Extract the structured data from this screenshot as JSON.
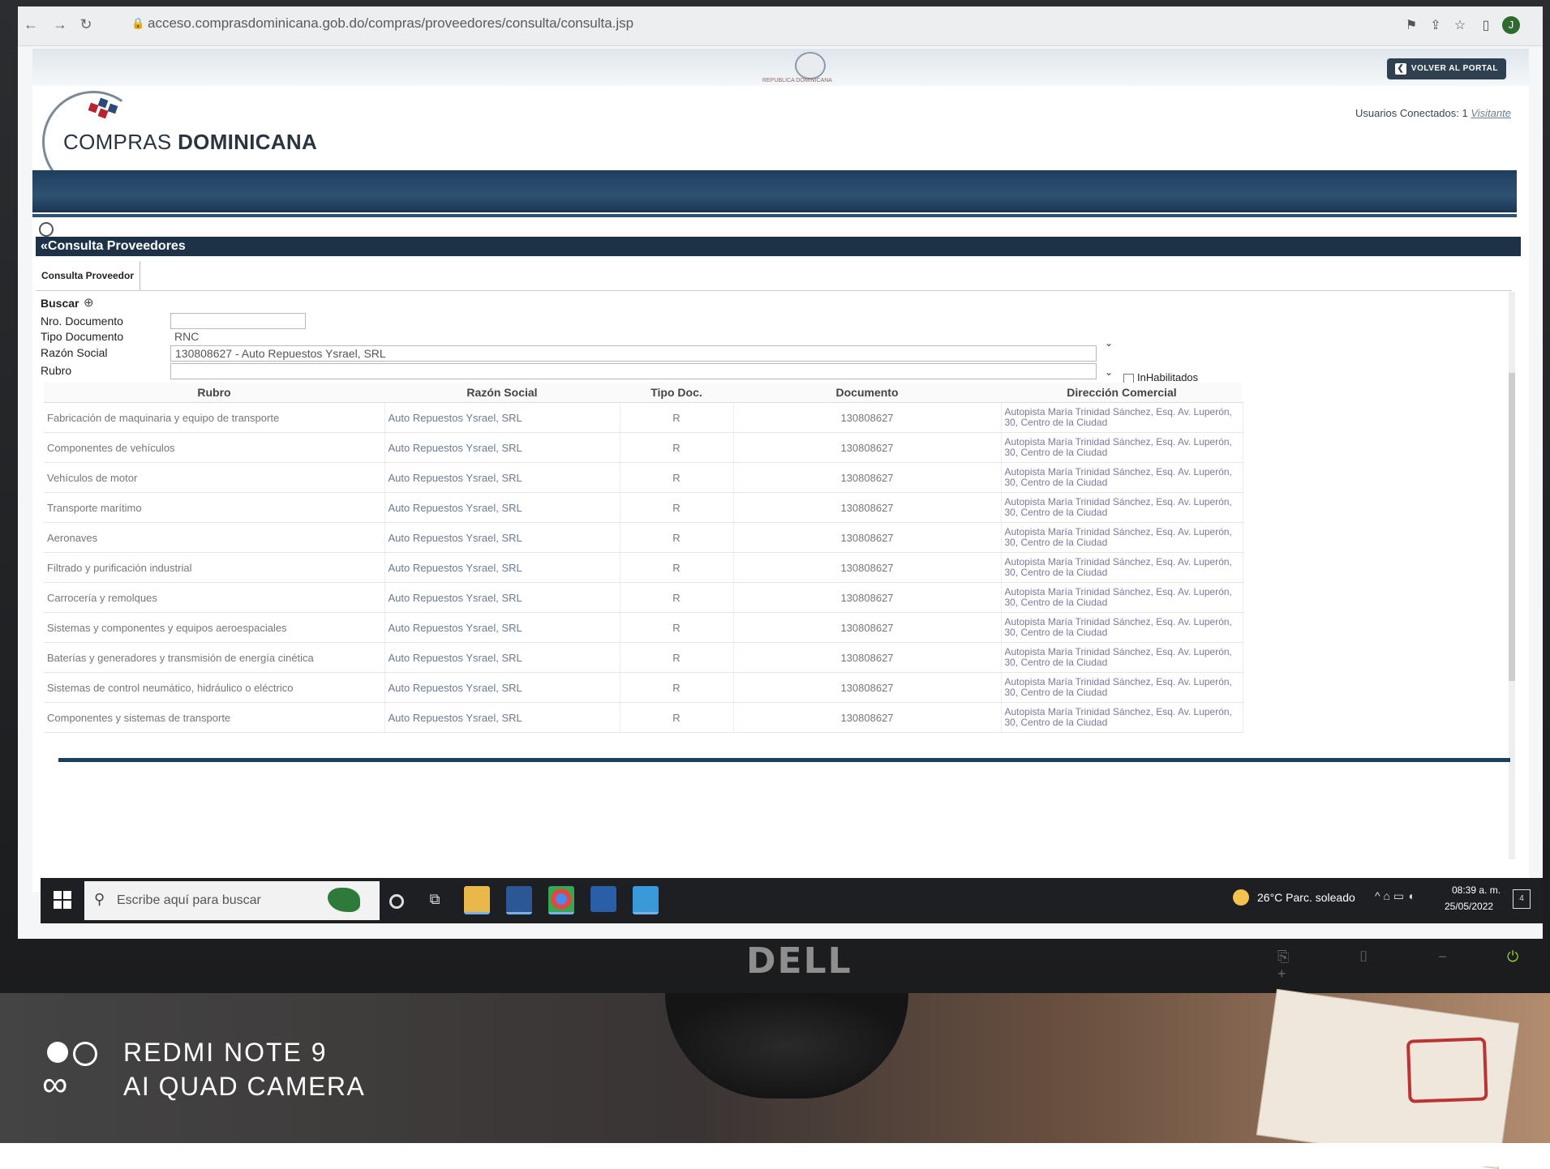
{
  "browser": {
    "url": "acceso.comprasdominicana.gob.do/compras/proveedores/consulta/consulta.jsp"
  },
  "header": {
    "crest_caption": "REPUBLICA DOMINICANA",
    "volver_button": "VOLVER AL PORTAL",
    "logo_text_light": "COMPRAS ",
    "logo_text_bold": "DOMINICANA",
    "users_label": "Usuarios Conectados: 1",
    "users_link": "Visitante"
  },
  "section_title": "«Consulta Proveedores",
  "tab_label": "Consulta Proveedor",
  "form": {
    "buscar_label": "Buscar",
    "nro_documento_label": "Nro. Documento",
    "nro_documento_value": "",
    "tipo_documento_label": "Tipo Documento",
    "tipo_documento_value": "RNC",
    "razon_social_label": "Razón Social",
    "razon_social_value": "130808627 - Auto Repuestos Ysrael, SRL",
    "rubro_label": "Rubro",
    "rubro_value": "",
    "inhabilitados_label": "InHabilitados"
  },
  "table": {
    "headers": [
      "Rubro",
      "Razón Social",
      "Tipo Doc.",
      "Documento",
      "Dirección Comercial"
    ],
    "rows": [
      [
        "Fabricación de maquinaria y equipo de transporte",
        "Auto Repuestos Ysrael, SRL",
        "R",
        "130808627",
        "Autopista María Trinidad Sánchez, Esq. Av. Luperón, 30, Centro de la Ciudad"
      ],
      [
        "Componentes de vehículos",
        "Auto Repuestos Ysrael, SRL",
        "R",
        "130808627",
        "Autopista María Trinidad Sánchez, Esq. Av. Luperón, 30, Centro de la Ciudad"
      ],
      [
        "Vehículos de motor",
        "Auto Repuestos Ysrael, SRL",
        "R",
        "130808627",
        "Autopista María Trinidad Sánchez, Esq. Av. Luperón, 30, Centro de la Ciudad"
      ],
      [
        "Transporte marítimo",
        "Auto Repuestos Ysrael, SRL",
        "R",
        "130808627",
        "Autopista María Trinidad Sánchez, Esq. Av. Luperón, 30, Centro de la Ciudad"
      ],
      [
        "Aeronaves",
        "Auto Repuestos Ysrael, SRL",
        "R",
        "130808627",
        "Autopista María Trinidad Sánchez, Esq. Av. Luperón, 30, Centro de la Ciudad"
      ],
      [
        "Filtrado y purificación industrial",
        "Auto Repuestos Ysrael, SRL",
        "R",
        "130808627",
        "Autopista María Trinidad Sánchez, Esq. Av. Luperón, 30, Centro de la Ciudad"
      ],
      [
        "Carrocería y remolques",
        "Auto Repuestos Ysrael, SRL",
        "R",
        "130808627",
        "Autopista María Trinidad Sánchez, Esq. Av. Luperón, 30, Centro de la Ciudad"
      ],
      [
        "Sistemas y componentes y equipos aeroespaciales",
        "Auto Repuestos Ysrael, SRL",
        "R",
        "130808627",
        "Autopista María Trinidad Sánchez, Esq. Av. Luperón, 30, Centro de la Ciudad"
      ],
      [
        "Baterías y generadores y transmisión de energía cinética",
        "Auto Repuestos Ysrael, SRL",
        "R",
        "130808627",
        "Autopista María Trinidad Sánchez, Esq. Av. Luperón, 30, Centro de la Ciudad"
      ],
      [
        "Sistemas de control neumático, hidráulico o eléctrico",
        "Auto Repuestos Ysrael, SRL",
        "R",
        "130808627",
        "Autopista María Trinidad Sánchez, Esq. Av. Luperón, 30, Centro de la Ciudad"
      ],
      [
        "Componentes y sistemas de transporte",
        "Auto Repuestos Ysrael, SRL",
        "R",
        "130808627",
        "Autopista María Trinidad Sánchez, Esq. Av. Luperón, 30, Centro de la Ciudad"
      ]
    ]
  },
  "taskbar": {
    "search_placeholder": "Escribe aquí para buscar",
    "weather": "26°C  Parc. soleado",
    "time": "08:39 a. m.",
    "date": "25/05/2022",
    "notification_count": "4"
  },
  "monitor": {
    "brand": "DELL"
  },
  "watermark": {
    "line1": "REDMI NOTE 9",
    "line2": "AI QUAD CAMERA"
  },
  "colors": {
    "header_band": "#2e5272",
    "section_title_bg": "#1e3247",
    "taskbar_bg": "#1d1f23"
  }
}
